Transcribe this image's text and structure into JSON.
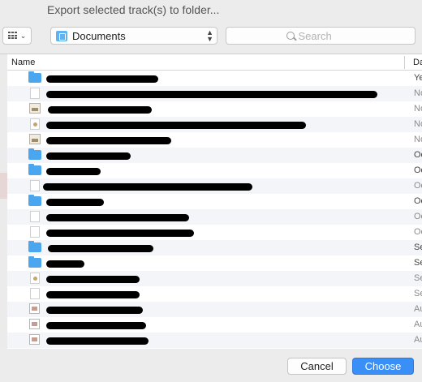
{
  "window": {
    "title": "Export selected track(s) to folder..."
  },
  "toolbar": {
    "location": "Documents",
    "search_placeholder": "Search"
  },
  "columns": {
    "name": "Name",
    "date": "Da"
  },
  "rows": [
    {
      "kind": "folder",
      "date": "Ye"
    },
    {
      "kind": "doc",
      "date": "No"
    },
    {
      "kind": "picture",
      "date": "No"
    },
    {
      "kind": "pdf",
      "date": "No"
    },
    {
      "kind": "picture",
      "date": "No"
    },
    {
      "kind": "folder",
      "date": "Oc"
    },
    {
      "kind": "folder",
      "date": "Oc"
    },
    {
      "kind": "doc",
      "date": "Oc"
    },
    {
      "kind": "folder",
      "date": "Oc"
    },
    {
      "kind": "doc",
      "date": "Oc"
    },
    {
      "kind": "doc",
      "date": "Oc"
    },
    {
      "kind": "folder",
      "date": "Se"
    },
    {
      "kind": "folder",
      "date": "Se"
    },
    {
      "kind": "pdf",
      "date": "Se"
    },
    {
      "kind": "doc",
      "date": "Se"
    },
    {
      "kind": "sheet",
      "date": "Au"
    },
    {
      "kind": "sheet",
      "date": "Au"
    },
    {
      "kind": "sheet",
      "date": "Au"
    }
  ],
  "buttons": {
    "cancel": "Cancel",
    "choose": "Choose"
  }
}
